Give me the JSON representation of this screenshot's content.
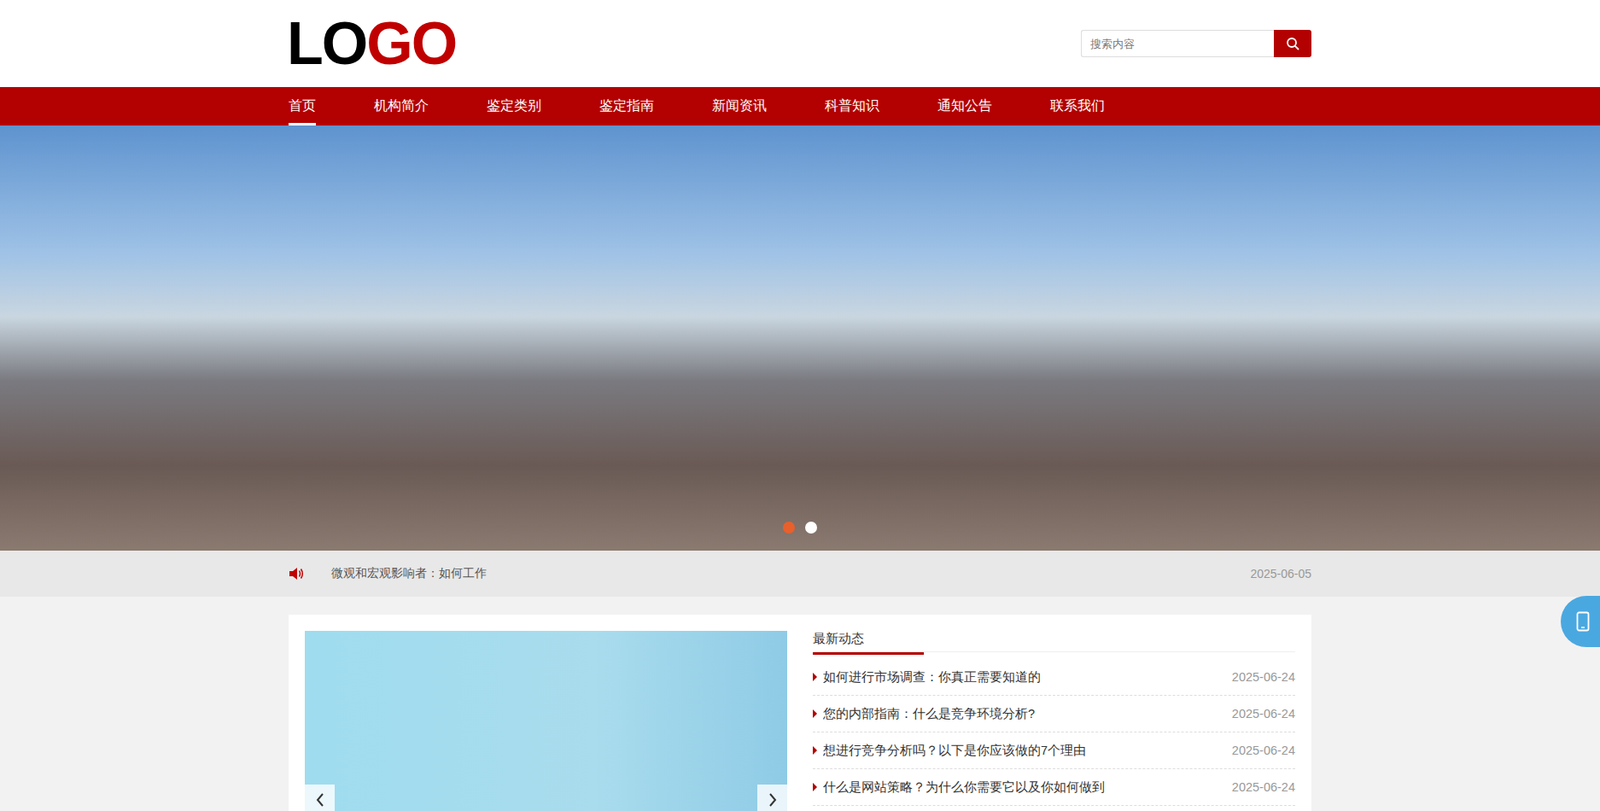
{
  "header": {
    "logo": {
      "dark": "LO",
      "accent": "GO"
    },
    "search": {
      "placeholder": "搜索内容"
    }
  },
  "nav": [
    {
      "label": "首页",
      "selected": true
    },
    {
      "label": "机构简介",
      "selected": false
    },
    {
      "label": "鉴定类别",
      "selected": false
    },
    {
      "label": "鉴定指南",
      "selected": false
    },
    {
      "label": "新闻资讯",
      "selected": false
    },
    {
      "label": "科普知识",
      "selected": false
    },
    {
      "label": "通知公告",
      "selected": false
    },
    {
      "label": "联系我们",
      "selected": false
    }
  ],
  "banner": {
    "dots": [
      {
        "selected": true
      },
      {
        "selected": false
      }
    ]
  },
  "notice": {
    "text": "微观和宏观影响者：如何工作",
    "date": "2025-06-05"
  },
  "latest": {
    "title": "最新动态",
    "items": [
      {
        "title": "如何进行市场调查：你真正需要知道的",
        "date": "2025-06-24"
      },
      {
        "title": "您的内部指南：什么是竞争环境分析?",
        "date": "2025-06-24"
      },
      {
        "title": "想进行竞争分析吗？以下是你应该做的7个理由",
        "date": "2025-06-24"
      },
      {
        "title": "什么是网站策略？为什么你需要它以及你如何做到",
        "date": "2025-06-24"
      }
    ]
  }
}
